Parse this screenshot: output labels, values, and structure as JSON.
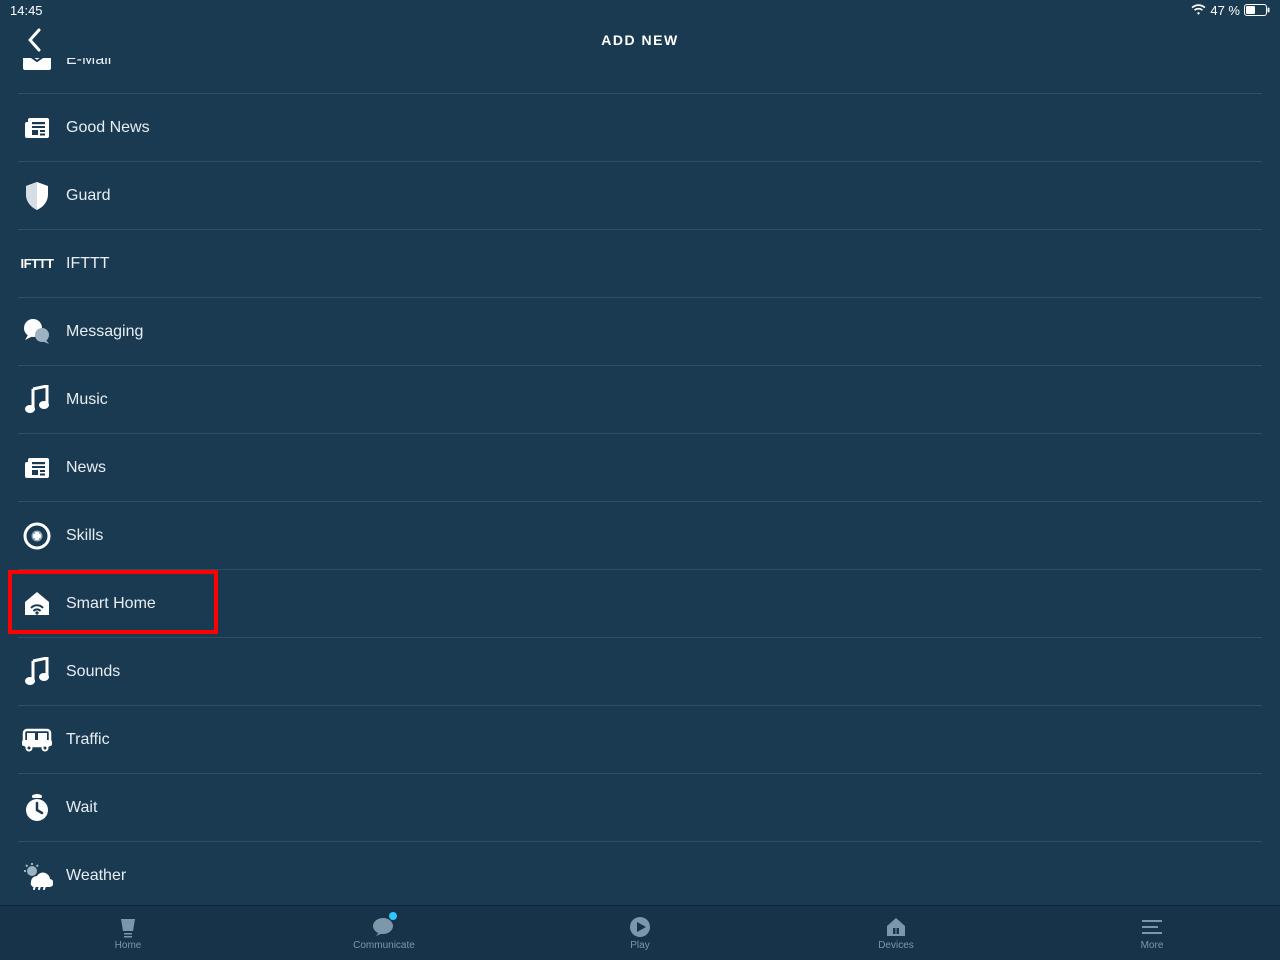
{
  "status": {
    "time": "14:45",
    "battery_pct": "47 %"
  },
  "header": {
    "title": "ADD NEW"
  },
  "list": {
    "items": [
      {
        "icon": "email-icon",
        "label": "E-Mail"
      },
      {
        "icon": "newspaper-icon",
        "label": "Good News"
      },
      {
        "icon": "shield-icon",
        "label": "Guard"
      },
      {
        "icon": "ifttt-icon",
        "label": "IFTTT"
      },
      {
        "icon": "messaging-icon",
        "label": "Messaging"
      },
      {
        "icon": "music-icon",
        "label": "Music"
      },
      {
        "icon": "newspaper-icon",
        "label": "News"
      },
      {
        "icon": "skills-icon",
        "label": "Skills"
      },
      {
        "icon": "smarthome-icon",
        "label": "Smart Home"
      },
      {
        "icon": "music-icon",
        "label": "Sounds"
      },
      {
        "icon": "traffic-icon",
        "label": "Traffic"
      },
      {
        "icon": "wait-icon",
        "label": "Wait"
      },
      {
        "icon": "weather-icon",
        "label": "Weather"
      }
    ],
    "highlighted_index": 8
  },
  "tabs": {
    "items": [
      {
        "icon": "home-tab-icon",
        "label": "Home",
        "notification": false
      },
      {
        "icon": "communicate-tab-icon",
        "label": "Communicate",
        "notification": true
      },
      {
        "icon": "play-tab-icon",
        "label": "Play",
        "notification": false
      },
      {
        "icon": "devices-tab-icon",
        "label": "Devices",
        "notification": false
      },
      {
        "icon": "more-tab-icon",
        "label": "More",
        "notification": false
      }
    ]
  }
}
